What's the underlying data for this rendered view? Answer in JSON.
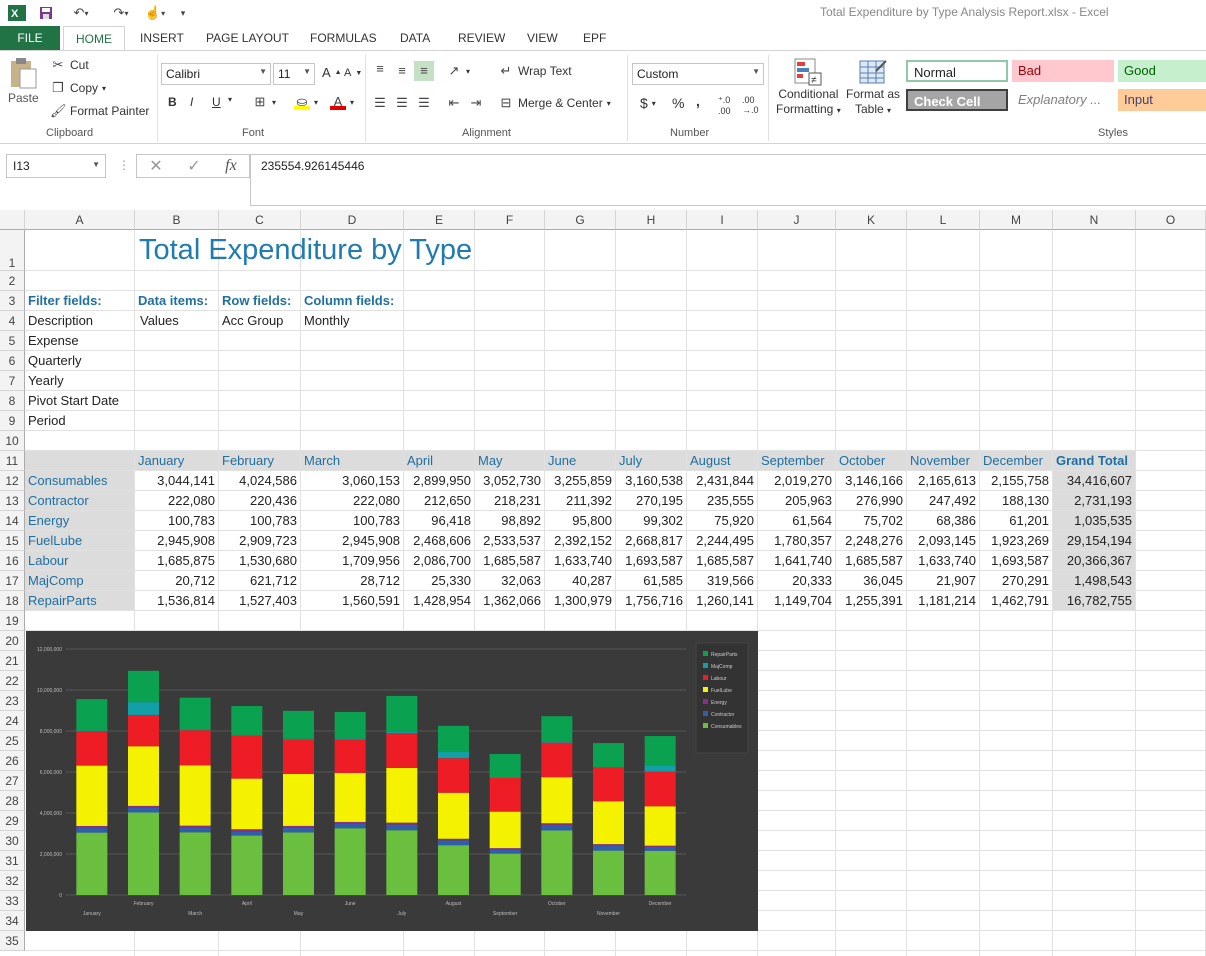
{
  "window": {
    "title": "Total Expenditure by Type Analysis Report.xlsx - Excel"
  },
  "tabs": [
    "FILE",
    "HOME",
    "INSERT",
    "PAGE LAYOUT",
    "FORMULAS",
    "DATA",
    "REVIEW",
    "VIEW",
    "EPF"
  ],
  "ribbon": {
    "clipboard": {
      "paste": "Paste",
      "cut": "Cut",
      "copy": "Copy",
      "format_painter": "Format Painter",
      "label": "Clipboard"
    },
    "font": {
      "name": "Calibri",
      "size": "11",
      "label": "Font",
      "bold": "B",
      "italic": "I",
      "underline": "U"
    },
    "alignment": {
      "wrap_text": "Wrap Text",
      "merge_center": "Merge & Center",
      "label": "Alignment"
    },
    "number": {
      "format": "Custom",
      "label": "Number",
      "currency": "$",
      "percent": "%",
      "comma": ","
    },
    "styles": {
      "conditional_formatting": [
        "Conditional",
        "Formatting"
      ],
      "format_as_table": [
        "Format as",
        "Table"
      ],
      "normal": "Normal",
      "bad": "Bad",
      "good": "Good",
      "check_cell": "Check Cell",
      "explanatory": "Explanatory ...",
      "input": "Input",
      "label": "Styles"
    }
  },
  "formula_bar": {
    "name_box": "I13",
    "value": "235554.926145446"
  },
  "columns": [
    "A",
    "B",
    "C",
    "D",
    "E",
    "F",
    "G",
    "H",
    "I",
    "J",
    "K",
    "L",
    "M",
    "N",
    "O"
  ],
  "rows": [
    "1",
    "2",
    "3",
    "4",
    "5",
    "6",
    "7",
    "8",
    "9",
    "10",
    "11",
    "12",
    "13",
    "14",
    "15",
    "16",
    "17",
    "18",
    "19",
    "20",
    "21",
    "22",
    "23",
    "24",
    "25",
    "26",
    "27",
    "28",
    "29",
    "30",
    "31",
    "32",
    "33",
    "34",
    "35"
  ],
  "sheet": {
    "title": "Total Expenditure by Type",
    "filter_fields_label": "Filter fields:",
    "data_items_label": "Data items:",
    "row_fields_label": "Row fields:",
    "column_fields_label": "Column fields:",
    "filters": [
      "Description",
      "Expense",
      "Quarterly",
      "Yearly",
      " Pivot Start Date",
      " Period"
    ],
    "data_item": "Values",
    "row_field": "Acc Group",
    "column_field": "Monthly",
    "months": [
      "January",
      "February",
      "March",
      "April",
      "May",
      "June",
      "July",
      "August",
      "September",
      "October",
      "November",
      "December"
    ],
    "grand_total_label": "Grand Total",
    "table": [
      {
        "name": "Consumables",
        "values": [
          "3,044,141",
          "4,024,586",
          "3,060,153",
          "2,899,950",
          "3,052,730",
          "3,255,859",
          "3,160,538",
          "2,431,844",
          "2,019,270",
          "3,146,166",
          "2,165,613",
          "2,155,758"
        ],
        "total": "34,416,607"
      },
      {
        "name": "Contractor",
        "values": [
          "222,080",
          "220,436",
          "222,080",
          "212,650",
          "218,231",
          "211,392",
          "270,195",
          "235,555",
          "205,963",
          "276,990",
          "247,492",
          "188,130"
        ],
        "total": "2,731,193"
      },
      {
        "name": "Energy",
        "values": [
          "100,783",
          "100,783",
          "100,783",
          "96,418",
          "98,892",
          "95,800",
          "99,302",
          "75,920",
          "61,564",
          "75,702",
          "68,386",
          "61,201"
        ],
        "total": "1,035,535"
      },
      {
        "name": "FuelLube",
        "values": [
          "2,945,908",
          "2,909,723",
          "2,945,908",
          "2,468,606",
          "2,533,537",
          "2,392,152",
          "2,668,817",
          "2,244,495",
          "1,780,357",
          "2,248,276",
          "2,093,145",
          "1,923,269"
        ],
        "total": "29,154,194"
      },
      {
        "name": "Labour",
        "values": [
          "1,685,875",
          "1,530,680",
          "1,709,956",
          "2,086,700",
          "1,685,587",
          "1,633,740",
          "1,693,587",
          "1,685,587",
          "1,641,740",
          "1,685,587",
          "1,633,740",
          "1,693,587"
        ],
        "total": "20,366,367"
      },
      {
        "name": "MajComp",
        "values": [
          "20,712",
          "621,712",
          "28,712",
          "25,330",
          "32,063",
          "40,287",
          "61,585",
          "319,566",
          "20,333",
          "36,045",
          "21,907",
          "270,291"
        ],
        "total": "1,498,543"
      },
      {
        "name": "RepairParts",
        "values": [
          "1,536,814",
          "1,527,403",
          "1,560,591",
          "1,428,954",
          "1,362,066",
          "1,300,979",
          "1,756,716",
          "1,260,141",
          "1,149,704",
          "1,255,391",
          "1,181,214",
          "1,462,791"
        ],
        "total": "16,782,755"
      }
    ]
  },
  "chart_data": {
    "type": "bar",
    "stacked": true,
    "categories": [
      "January",
      "February",
      "March",
      "April",
      "May",
      "June",
      "July",
      "August",
      "September",
      "October",
      "November",
      "December"
    ],
    "ylim": [
      0,
      12000000
    ],
    "yticks": [
      "0",
      "2,000,000",
      "4,000,000",
      "6,000,000",
      "8,000,000",
      "10,000,000",
      "12,000,000"
    ],
    "legend_position": "right",
    "series": [
      {
        "name": "Consumables",
        "color": "#6abf3f",
        "values": [
          3044141,
          4024586,
          3060153,
          2899950,
          3052730,
          3255859,
          3160538,
          2431844,
          2019270,
          3146166,
          2165613,
          2155758
        ]
      },
      {
        "name": "Contractor",
        "color": "#2e5fa8",
        "values": [
          222080,
          220436,
          222080,
          212650,
          218231,
          211392,
          270195,
          235555,
          205963,
          276990,
          247492,
          188130
        ]
      },
      {
        "name": "Energy",
        "color": "#8a2d8f",
        "values": [
          100783,
          100783,
          100783,
          96418,
          98892,
          95800,
          99302,
          75920,
          61564,
          75702,
          68386,
          61201
        ]
      },
      {
        "name": "FuelLube",
        "color": "#f5f200",
        "values": [
          2945908,
          2909723,
          2945908,
          2468606,
          2533537,
          2392152,
          2668817,
          2244495,
          1780357,
          2248276,
          2093145,
          1923269
        ]
      },
      {
        "name": "Labour",
        "color": "#ee1c25",
        "values": [
          1685875,
          1530680,
          1709956,
          2086700,
          1685587,
          1633740,
          1693587,
          1685587,
          1641740,
          1685587,
          1633740,
          1693587
        ]
      },
      {
        "name": "MajComp",
        "color": "#12a0a8",
        "values": [
          20712,
          621712,
          28712,
          25330,
          32063,
          40287,
          61585,
          319566,
          20333,
          36045,
          21907,
          270291
        ]
      },
      {
        "name": "RepairParts",
        "color": "#0aa150",
        "values": [
          1536814,
          1527403,
          1560591,
          1428954,
          1362066,
          1300979,
          1756716,
          1260141,
          1149704,
          1255391,
          1181214,
          1462791
        ]
      }
    ]
  }
}
